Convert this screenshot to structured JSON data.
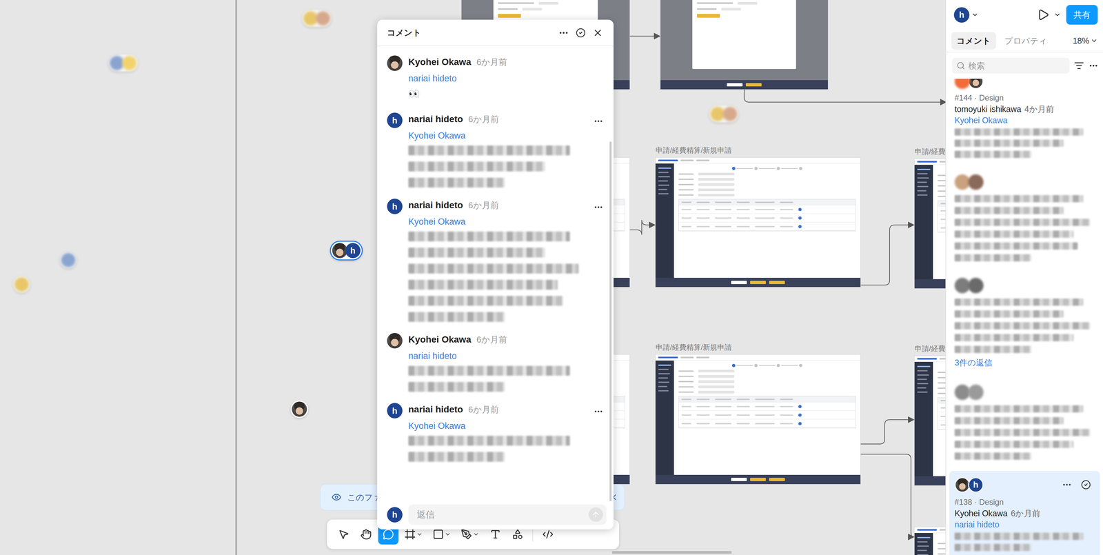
{
  "canvas": {
    "frames": [
      {
        "kind": "dialog"
      },
      {
        "kind": "dialog"
      },
      {
        "kind": "form"
      },
      {
        "kind": "form"
      },
      {
        "kind": "form",
        "label": "申請/経費精算/新規申請"
      },
      {
        "kind": "form",
        "label": "申請/経費精算/新規申請"
      },
      {
        "kind": "form",
        "label": "申請/経費"
      },
      {
        "kind": "form",
        "label": "申請/経費"
      },
      {
        "kind": "form"
      }
    ],
    "pins": [
      {
        "kind": "redacted",
        "avatars": 2
      },
      {
        "kind": "redacted",
        "avatars": 2
      },
      {
        "kind": "redacted",
        "avatars": 2
      },
      {
        "kind": "redacted",
        "avatars": 1
      },
      {
        "kind": "redacted",
        "avatars": 1
      },
      {
        "kind": "thread",
        "initial": "h",
        "selected": true
      },
      {
        "kind": "photo"
      }
    ]
  },
  "banner": {
    "text": "このファ"
  },
  "toolbar": {
    "tools": [
      {
        "kind": "move",
        "selected": false,
        "dropdown": false
      },
      {
        "kind": "hand",
        "selected": false,
        "dropdown": false
      },
      {
        "kind": "comment",
        "selected": true,
        "dropdown": false
      },
      {
        "kind": "frame",
        "selected": false,
        "dropdown": true
      },
      {
        "kind": "shape",
        "selected": false,
        "dropdown": true
      },
      {
        "kind": "pen",
        "selected": false,
        "dropdown": true
      },
      {
        "kind": "text",
        "selected": false,
        "dropdown": false
      },
      {
        "kind": "assets",
        "selected": false,
        "dropdown": false
      },
      {
        "kind": "dev",
        "selected": false,
        "dropdown": false
      }
    ]
  },
  "comment_popup": {
    "title": "コメント",
    "comments": [
      {
        "author": "Kyohei Okawa",
        "avatar": {
          "kind": "photo"
        },
        "time": "6か月前",
        "mention": "nariai hideto",
        "body": "👀",
        "redacted_lines": 0,
        "has_menu": false
      },
      {
        "author": "nariai hideto",
        "avatar": {
          "kind": "initial",
          "initial": "h"
        },
        "time": "6か月前",
        "mention": "Kyohei Okawa",
        "redacted_lines": 3,
        "has_menu": true
      },
      {
        "author": "nariai hideto",
        "avatar": {
          "kind": "initial",
          "initial": "h"
        },
        "time": "6か月前",
        "mention": "Kyohei Okawa",
        "redacted_lines": 6,
        "has_menu": true
      },
      {
        "author": "Kyohei Okawa",
        "avatar": {
          "kind": "photo"
        },
        "time": "6か月前",
        "mention": "nariai hideto",
        "redacted_lines": 2,
        "has_menu": false
      },
      {
        "author": "nariai hideto",
        "avatar": {
          "kind": "initial",
          "initial": "h"
        },
        "time": "6か月前",
        "mention": "Kyohei Okawa",
        "redacted_lines": 2,
        "has_menu": true
      }
    ],
    "reply": {
      "initial": "h",
      "placeholder": "返信"
    }
  },
  "right_panel": {
    "user": {
      "initial": "h"
    },
    "share": "共有",
    "tabs": [
      {
        "label": "コメント",
        "selected": true
      },
      {
        "label": "プロパティ",
        "selected": false
      }
    ],
    "zoom": "18%",
    "search": {
      "placeholder": "検索"
    },
    "threads": [
      {
        "kind": "visible",
        "avatars": [
          {
            "kind": "redacted",
            "color": "#f26b3a"
          },
          {
            "kind": "photo"
          }
        ],
        "meta": "#144 · Design",
        "author": "tomoyuki ishikawa",
        "time": "4か月前",
        "mention": "Kyohei Okawa",
        "redacted_lines": 3,
        "selected": false
      },
      {
        "kind": "redacted",
        "avatars": [
          {
            "kind": "redacted",
            "color": "#c9a27e"
          },
          {
            "kind": "redacted",
            "color": "#8a6a58"
          }
        ],
        "redacted_lines": 6,
        "selected": false
      },
      {
        "kind": "redacted",
        "avatars": [
          {
            "kind": "redacted",
            "color": "#7d7d7d"
          },
          {
            "kind": "redacted",
            "color": "#6a6a6a"
          }
        ],
        "redacted_lines": 5,
        "replies": "3件の返信",
        "selected": false
      },
      {
        "kind": "redacted",
        "avatars": [
          {
            "kind": "redacted",
            "color": "#8c8c8c"
          },
          {
            "kind": "redacted",
            "color": "#9a9a9a"
          }
        ],
        "redacted_lines": 5,
        "selected": false
      },
      {
        "kind": "visible",
        "avatars": [
          {
            "kind": "photo"
          },
          {
            "kind": "initial",
            "initial": "h"
          }
        ],
        "meta": "#138 · Design",
        "author": "Kyohei Okawa",
        "time": "6か月前",
        "mention": "nariai hideto",
        "redacted_lines": 2,
        "selected": true
      }
    ]
  }
}
